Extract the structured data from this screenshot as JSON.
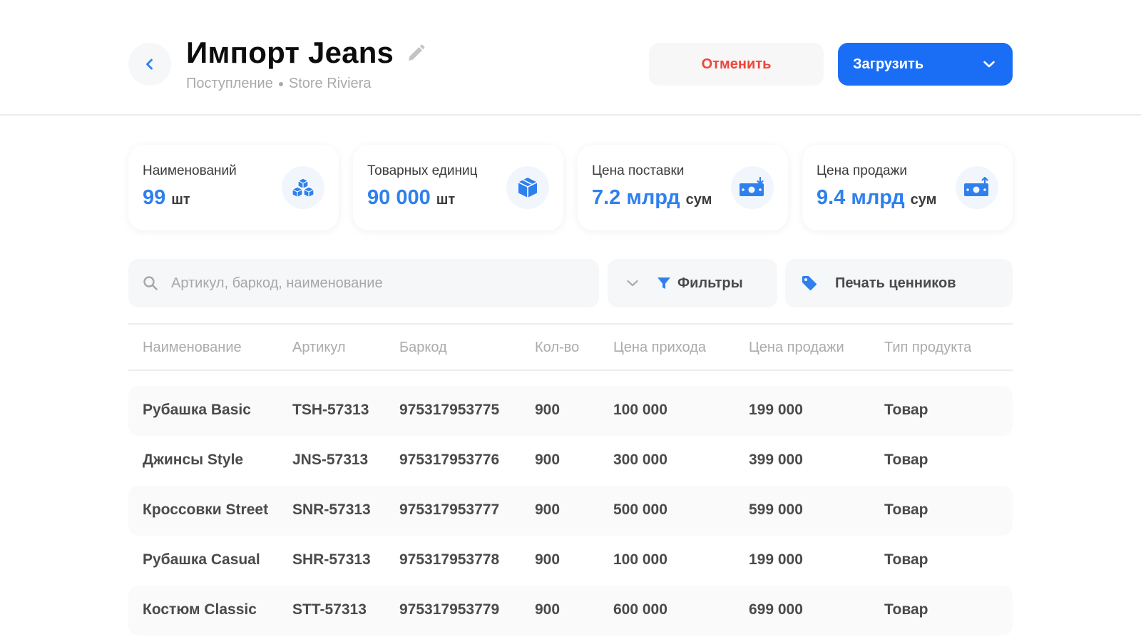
{
  "header": {
    "title": "Импорт Jeans",
    "subtitle_type": "Поступление",
    "subtitle_store": "Store Riviera",
    "cancel_label": "Отменить",
    "upload_label": "Загрузить"
  },
  "stats": [
    {
      "label": "Наименований",
      "value": "99",
      "unit": "шт",
      "icon": "cubes-icon"
    },
    {
      "label": "Товарных единиц",
      "value": "90 000",
      "unit": "шт",
      "icon": "box-icon"
    },
    {
      "label": "Цена поставки",
      "value": "7.2 млрд",
      "unit": "сум",
      "icon": "money-in-icon"
    },
    {
      "label": "Цена продажи",
      "value": "9.4 млрд",
      "unit": "сум",
      "icon": "money-out-icon"
    }
  ],
  "toolbar": {
    "search_placeholder": "Артикул, баркод, наименование",
    "search_value": "",
    "filters_label": "Фильтры",
    "print_label": "Печать ценников"
  },
  "table": {
    "columns": [
      "Наименование",
      "Артикул",
      "Баркод",
      "Кол-во",
      "Цена прихода",
      "Цена продажи",
      "Тип продукта"
    ],
    "rows": [
      [
        "Рубашка Basic",
        "TSH-57313",
        "975317953775",
        "900",
        "100 000",
        "199 000",
        "Товар"
      ],
      [
        "Джинсы Style",
        "JNS-57313",
        "975317953776",
        "900",
        "300 000",
        "399 000",
        "Товар"
      ],
      [
        "Кроссовки Street",
        "SNR-57313",
        "975317953777",
        "900",
        "500 000",
        "599 000",
        "Товар"
      ],
      [
        "Рубашка Casual",
        "SHR-57313",
        "975317953778",
        "900",
        "100 000",
        "199 000",
        "Товар"
      ],
      [
        "Костюм Classic",
        "STT-57313",
        "975317953779",
        "900",
        "600 000",
        "699 000",
        "Товар"
      ]
    ]
  },
  "colors": {
    "accent": "#1a6ef5",
    "stat_value": "#2f80ed",
    "danger": "#f04438",
    "muted": "#a9a9a9"
  }
}
